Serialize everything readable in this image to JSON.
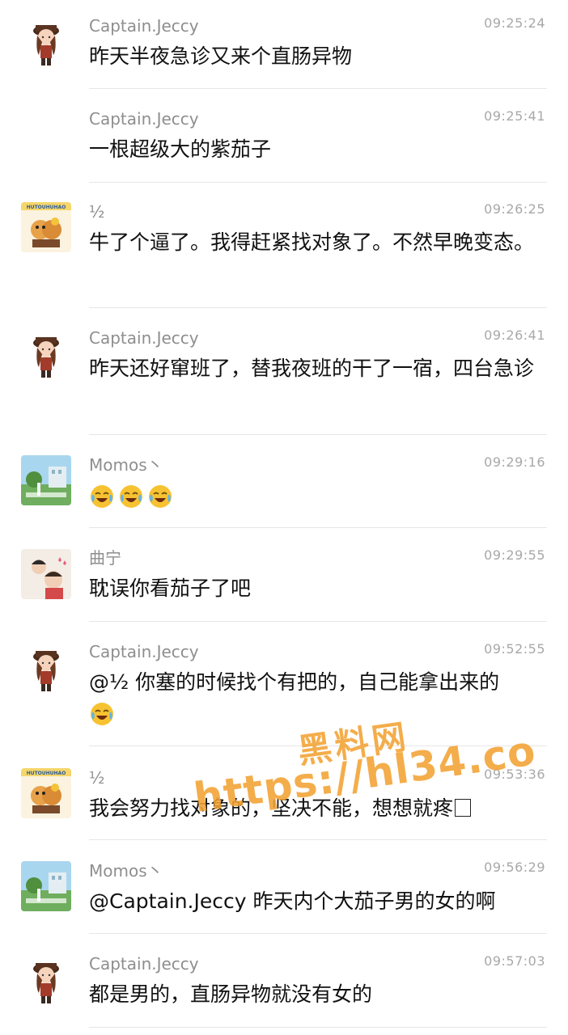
{
  "messages": [
    {
      "avatar": "pirate-girl-avatar",
      "name": "Captain.Jeccy",
      "time": "09:25:24",
      "text": "昨天半夜急诊又来个直肠异物"
    },
    {
      "avatar": "",
      "name": "Captain.Jeccy",
      "time": "09:25:41",
      "text": "一根超级大的紫茄子"
    },
    {
      "avatar": "cartoon-sticker-avatar",
      "name": "½",
      "time": "09:26:25",
      "text": "牛了个逼了。我得赶紧找对象了。不然早晚变态。"
    },
    {
      "avatar": "pirate-girl-avatar",
      "name": "Captain.Jeccy",
      "time": "09:26:41",
      "text": "昨天还好窜班了，替我夜班的干了一宿，四台急诊"
    },
    {
      "avatar": "landscape-photo-avatar",
      "name": "Momos丶",
      "time": "09:29:16",
      "text": ""
    },
    {
      "avatar": "parent-child-avatar",
      "name": "曲宁",
      "time": "09:29:55",
      "text": "耽误你看茄子了吧"
    },
    {
      "avatar": "pirate-girl-avatar",
      "name": "Captain.Jeccy",
      "time": "09:52:55",
      "text": "@½ 你塞的时候找个有把的，自己能拿出来的"
    },
    {
      "avatar": "cartoon-sticker-avatar",
      "name": "½",
      "time": "09:53:36",
      "text": "我会努力找对象的，坚决不能，想想就疼"
    },
    {
      "avatar": "landscape-photo-avatar",
      "name": "Momos丶",
      "time": "09:56:29",
      "text": "@Captain.Jeccy  昨天内个大茄子男的女的啊"
    },
    {
      "avatar": "pirate-girl-avatar",
      "name": "Captain.Jeccy",
      "time": "09:57:03",
      "text": "都是男的，直肠异物就没有女的"
    }
  ],
  "avatar_sticker_text": "HUTOUHUHAO",
  "watermark": {
    "line1": "黑料网",
    "line2": "https://hl34.co"
  },
  "colors": {
    "name": "#8e8e8e",
    "time": "#a8a8a8",
    "text": "#111111",
    "divider": "#e6e6e6",
    "watermark": "#f3a233"
  }
}
